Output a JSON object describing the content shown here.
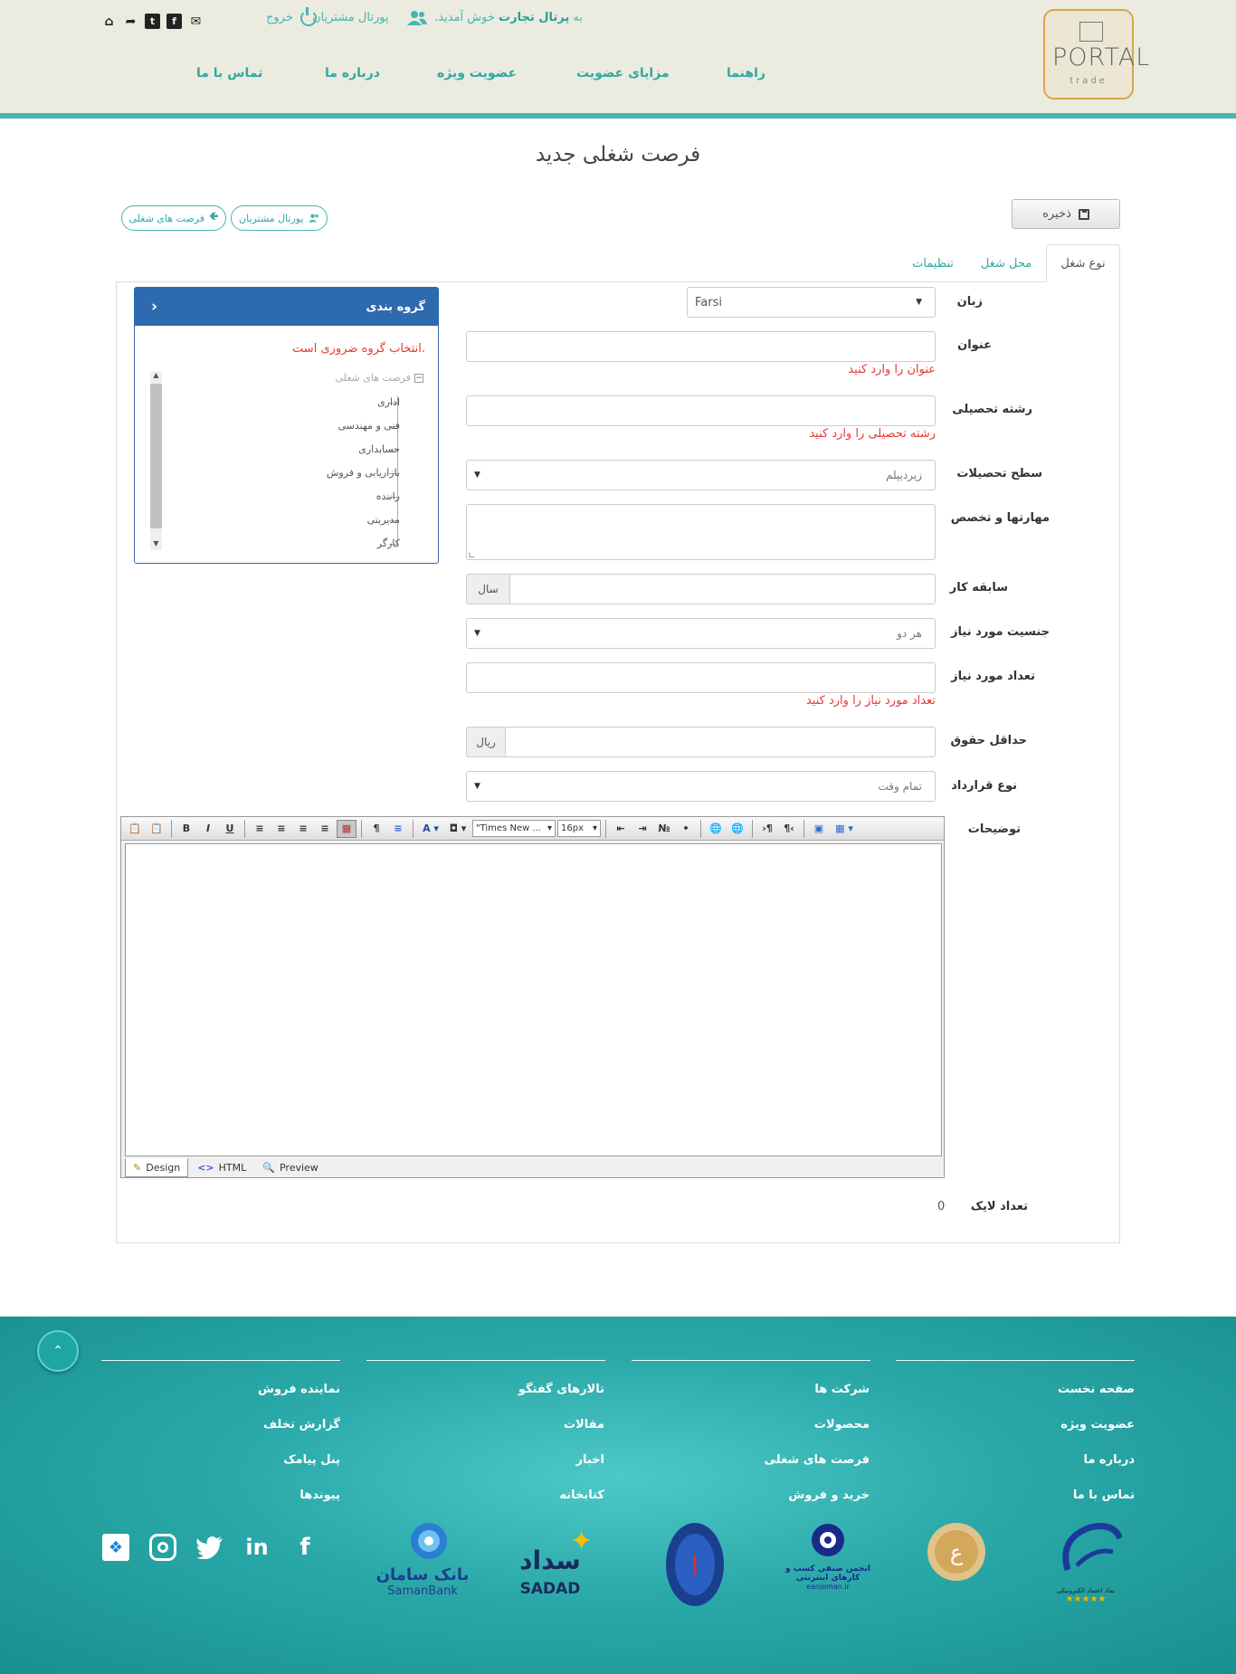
{
  "header": {
    "logo_text": "PORTAL",
    "logo_sub": "trade",
    "welcome_prefix": "به",
    "welcome_brand": "پرتال تجارت",
    "welcome_suffix": "خوش آمدید.",
    "portal_link": "پورتال مشتریان",
    "exit": "خروج",
    "nav": [
      "راهنما",
      "مزایای عضویت",
      "عضویت ویژه",
      "درباره ما",
      "تماس با ما"
    ]
  },
  "page": {
    "title": "فرصت شغلی جدید",
    "save_label": "ذخیره",
    "breadcrumb_portal": "پورتال مشتریان",
    "breadcrumb_jobs": "فرصت های شغلی"
  },
  "tabs": [
    "نوع شغل",
    "محل شغل",
    "تنظیمات"
  ],
  "form": {
    "language_label": "زبان",
    "language_value": "Farsi",
    "title_label": "عنوان",
    "title_error": "عنوان را وارد کنید",
    "field_label": "رشته تحصیلی",
    "field_error": "رشته تحصیلی را وارد کنید",
    "edu_label": "سطح تحصیلات",
    "edu_value": "زیردیپلم",
    "skills_label": "مهارتها و تخصص",
    "experience_label": "سابقه کار",
    "experience_unit": "سال",
    "gender_label": "جنسیت مورد نیاز",
    "gender_value": "هر دو",
    "count_label": "تعداد مورد نیاز",
    "count_error": "تعداد مورد نیاز را وارد کنید",
    "salary_label": "حداقل حقوق",
    "salary_unit": "ریال",
    "contract_label": "نوع قرارداد",
    "contract_value": "تمام وقت",
    "description_label": "توضیحات",
    "likes_label": "تعداد لایک",
    "likes_value": "0"
  },
  "group": {
    "title": "گروه بندی",
    "error": "انتخاب گروه ضروری است.",
    "root": "فرصت های شغلی",
    "items": [
      "اداری",
      "فنی و مهندسی",
      "حسابداری",
      "بازاریابی و فروش",
      "راننده",
      "مدیریتی",
      "کارگر"
    ]
  },
  "editor": {
    "font_name": "\"Times New ...",
    "font_size": "16px",
    "mode_tabs": [
      "Design",
      "HTML",
      "Preview"
    ]
  },
  "footer": {
    "col1": [
      "صفحه نخست",
      "عضویت ویژه",
      "درباره ما",
      "تماس با ما"
    ],
    "col2": [
      "شرکت ها",
      "محصولات",
      "فرصت های شغلی",
      "خرید و فروش"
    ],
    "col3": [
      "تالارهای گفتگو",
      "مقالات",
      "اخبار",
      "کتابخانه"
    ],
    "col4": [
      "نماینده فروش",
      "گزارش تخلف",
      "پنل پیامک",
      "پیوندها"
    ],
    "badges": {
      "enamad": "نماد اعتماد الکترونیکی",
      "anjoman": "انجمن صنفی کسب و کارهای اینترنتی",
      "anjoman_url": "eanjoman.ir",
      "sadad_fa": "سداد",
      "sadad_en": "SADAD",
      "saman_fa": "بانک سامان",
      "saman_en": "SamanBank"
    }
  },
  "colors": {
    "teal": "#46b6b0",
    "blue": "#2e6ab0",
    "error": "#e53935"
  }
}
